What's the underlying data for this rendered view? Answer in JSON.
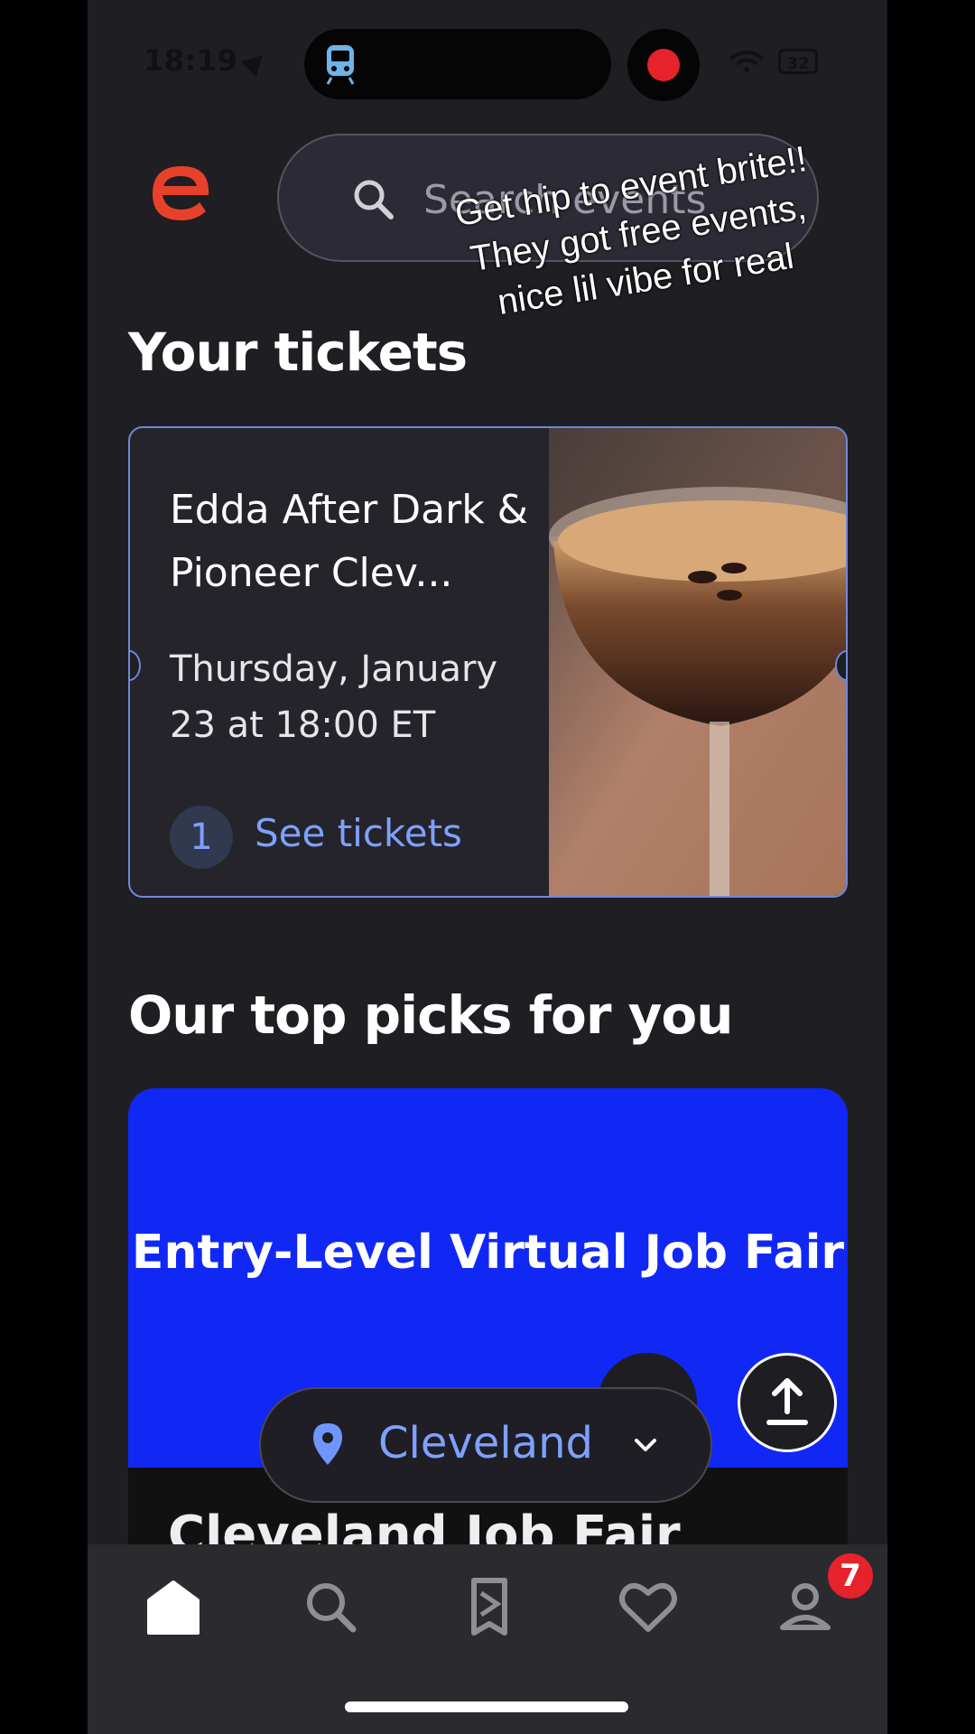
{
  "status_bar": {
    "time": "18:19",
    "battery": "32"
  },
  "search": {
    "placeholder": "Search events"
  },
  "overlay_caption": "Get hip to event brite!! They got free events, nice lil vibe for real",
  "tickets_section": {
    "heading": "Your tickets",
    "ticket": {
      "title": "Edda After Dark & Pioneer Clev...",
      "date": "Thursday, January 23 at 18:00 ET",
      "quantity": "1",
      "action": "See tickets"
    }
  },
  "picks_section": {
    "heading": "Our top picks for you",
    "card": {
      "banner_title": "Entry-Level Virtual Job Fair",
      "event_title": "Cleveland Job Fair"
    }
  },
  "location": {
    "city": "Cleveland"
  },
  "tab_bar": {
    "items": [
      "home-icon",
      "search-icon",
      "tickets-icon",
      "likes-icon",
      "profile-icon"
    ],
    "profile_badge": "7"
  },
  "colors": {
    "accent": "#7ea1ff",
    "brand": "#e8412b",
    "banner": "#1128f5",
    "badge": "#e6232a"
  }
}
